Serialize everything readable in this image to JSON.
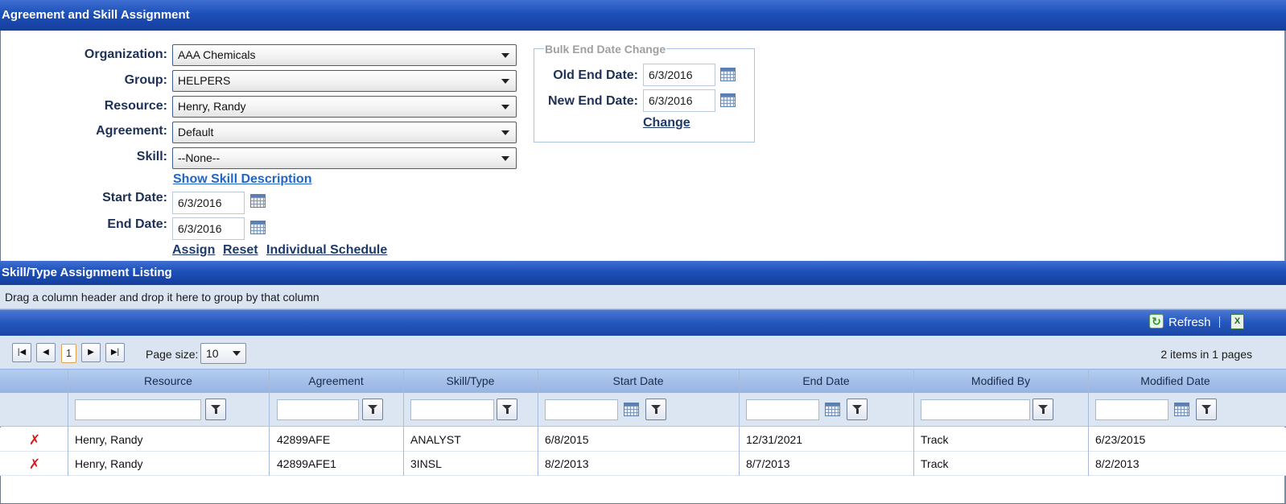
{
  "title": "Agreement and Skill Assignment",
  "form": {
    "organization_label": "Organization:",
    "organization_value": "AAA Chemicals",
    "group_label": "Group:",
    "group_value": "HELPERS",
    "resource_label": "Resource:",
    "resource_value": "Henry, Randy",
    "agreement_label": "Agreement:",
    "agreement_value": "Default",
    "skill_label": "Skill:",
    "skill_value": "--None--",
    "show_skill_description": "Show Skill Description",
    "start_date_label": "Start Date:",
    "start_date_value": "6/3/2016",
    "end_date_label": "End Date:",
    "end_date_value": "6/3/2016",
    "assign": "Assign",
    "reset": "Reset",
    "individual_schedule": "Individual Schedule"
  },
  "bulk": {
    "legend": "Bulk End Date Change",
    "old_label": "Old End Date:",
    "old_value": "6/3/2016",
    "new_label": "New End Date:",
    "new_value": "6/3/2016",
    "change": "Change"
  },
  "listing": {
    "title": "Skill/Type Assignment Listing",
    "group_hint": "Drag a column header and drop it here to group by that column",
    "refresh": "Refresh",
    "page_current": "1",
    "page_size_label": "Page size:",
    "page_size_value": "10",
    "page_info": "2 items in 1 pages",
    "columns": [
      "Resource",
      "Agreement",
      "Skill/Type",
      "Start Date",
      "End Date",
      "Modified By",
      "Modified Date"
    ],
    "rows": [
      [
        "Henry, Randy",
        "42899AFE",
        "ANALYST",
        "6/8/2015",
        "12/31/2021",
        "Track",
        "6/23/2015"
      ],
      [
        "Henry, Randy",
        "42899AFE1",
        "3INSL",
        "8/2/2013",
        "8/7/2013",
        "Track",
        "8/2/2013"
      ]
    ]
  },
  "colors": {
    "header_blue": "#1c4fb8",
    "label_navy": "#1d3156",
    "link_blue": "#1f66c8",
    "delete_red": "#d41c1c"
  },
  "icons": [
    "calendar-icon",
    "filter-icon",
    "refresh-icon",
    "excel-export-icon",
    "delete-icon",
    "first-page-icon",
    "prev-page-icon",
    "next-page-icon",
    "last-page-icon",
    "dropdown-arrow-icon"
  ]
}
